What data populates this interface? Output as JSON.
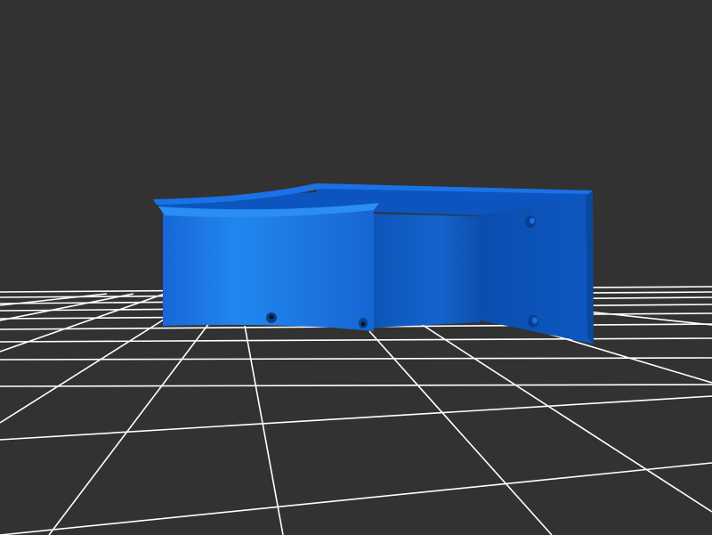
{
  "viewer": {
    "background_color": "#323232",
    "grid_color": "#ffffff",
    "model_color": "#1a6fe0",
    "model_highlight_color": "#2288f0",
    "model_shadow_color": "#0b4fb0"
  },
  "model": {
    "name_icon": "3d-model-icon"
  }
}
